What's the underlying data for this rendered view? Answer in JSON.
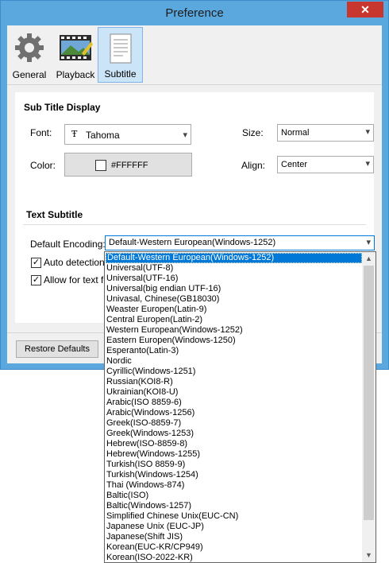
{
  "window": {
    "title": "Preference",
    "close_glyph": "✕"
  },
  "tabs": [
    {
      "label": "General",
      "icon": "gear-icon"
    },
    {
      "label": "Playback",
      "icon": "film-icon"
    },
    {
      "label": "Subtitle",
      "icon": "document-icon"
    }
  ],
  "subtitle_display": {
    "heading": "Sub Title Display",
    "font_label": "Font:",
    "font_value": "Tahoma",
    "size_label": "Size:",
    "size_value": "Normal",
    "color_label": "Color:",
    "color_value": "#FFFFFF",
    "align_label": "Align:",
    "align_value": "Center"
  },
  "text_subtitle": {
    "heading": "Text Subtitle",
    "encoding_label": "Default Encoding:",
    "encoding_value": "Default-Western European(Windows-1252)",
    "auto_detect_label": "Auto detection U",
    "allow_text_label": "Allow for text fo"
  },
  "footer": {
    "restore_label": "Restore Defaults"
  },
  "encoding_options": [
    "Default-Western European(Windows-1252)",
    "Universal(UTF-8)",
    "Universal(UTF-16)",
    "Universal(big endian UTF-16)",
    "Univasal, Chinese(GB18030)",
    "Weaster Europen(Latin-9)",
    "Central Europen(Latin-2)",
    "Western European(Windows-1252)",
    "Eastern Europen(Windows-1250)",
    "Esperanto(Latin-3)",
    "Nordic",
    "Cyrillic(Windows-1251)",
    "Russian(KOI8-R)",
    "Ukrainian(KOI8-U)",
    "Arabic(ISO 8859-6)",
    "Arabic(Windows-1256)",
    "Greek(ISO-8859-7)",
    "Greek(Windows-1253)",
    "Hebrew(ISO-8859-8)",
    "Hebrew(Windows-1255)",
    "Turkish(ISO 8859-9)",
    "Turkish(Windows-1254)",
    "Thai (Windows-874)",
    "Baltic(ISO)",
    "Baltic(Windows-1257)",
    "Simplified Chinese Unix(EUC-CN)",
    "Japanese Unix (EUC-JP)",
    "Japanese(Shift JIS)",
    "Korean(EUC-KR/CP949)",
    "Korean(ISO-2022-KR)"
  ],
  "colors": {
    "accent": "#0078d7",
    "window_frame": "#5ba8df",
    "swatch": "#FFFFFF"
  }
}
